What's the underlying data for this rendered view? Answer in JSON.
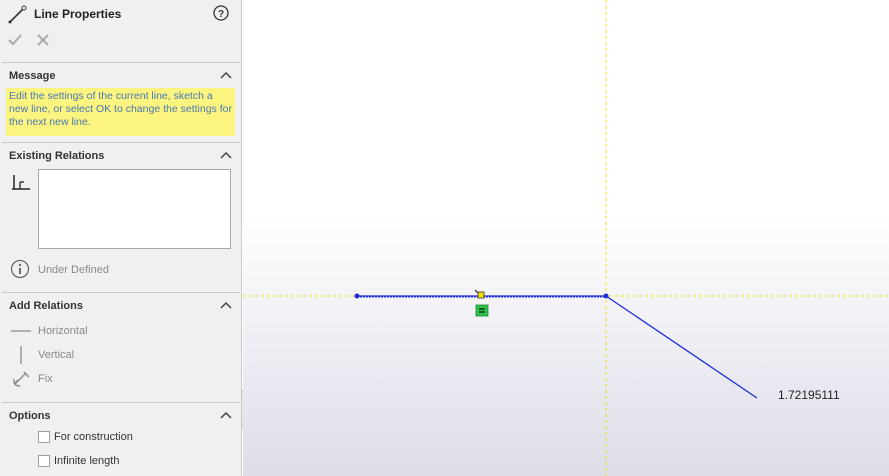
{
  "header": {
    "title": "Line Properties",
    "icons": {
      "title": "sketch-line-icon",
      "help": "help-icon",
      "ok": "checkmark-icon",
      "cancel": "close-icon"
    }
  },
  "message": {
    "title": "Message",
    "text": "Edit the settings of the current line, sketch a new line, or select OK to change the settings for the next new line."
  },
  "existing_relations": {
    "title": "Existing Relations",
    "items": [],
    "status": "Under Defined"
  },
  "add_relations": {
    "title": "Add Relations",
    "items": [
      {
        "label": "Horizontal",
        "icon": "horizontal-relation-icon"
      },
      {
        "label": "Vertical",
        "icon": "vertical-relation-icon"
      },
      {
        "label": "Fix",
        "icon": "fix-anchor-icon"
      }
    ]
  },
  "options": {
    "title": "Options",
    "items": [
      {
        "label": "For construction",
        "checked": false
      },
      {
        "label": "Infinite length",
        "checked": false
      }
    ]
  },
  "graphics": {
    "dimension_value": "1.72195111",
    "colors": {
      "sketch_line": "#1f2ed8",
      "inference_line": "#e8e000",
      "relation_badge": "#2ec24a"
    }
  }
}
